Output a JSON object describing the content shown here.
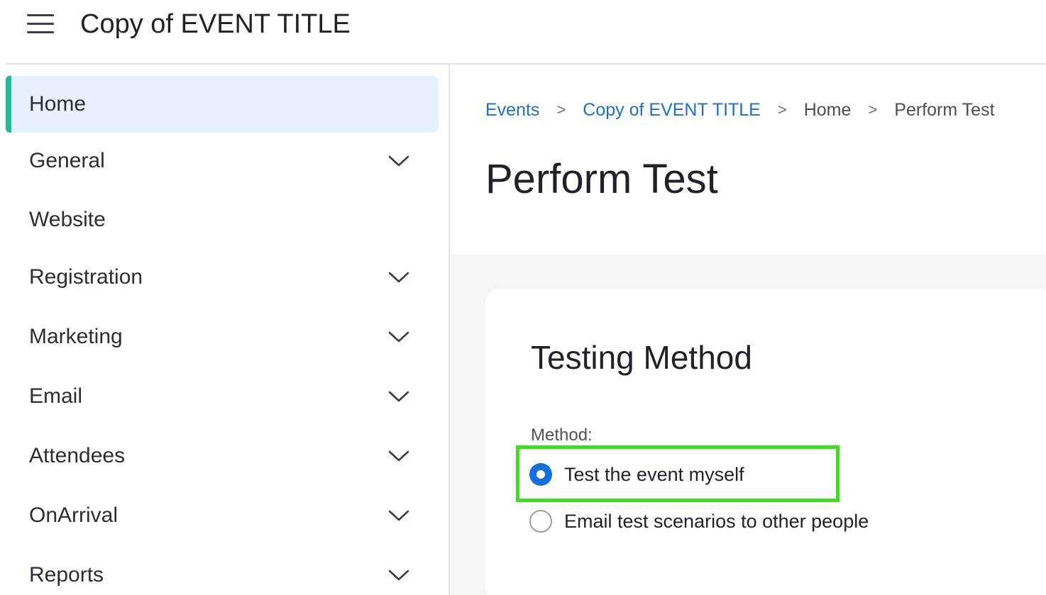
{
  "header": {
    "menu_icon": "hamburger-menu-icon",
    "title": "Copy of EVENT TITLE"
  },
  "sidebar": {
    "items": [
      {
        "label": "Home",
        "active": true,
        "expandable": false
      },
      {
        "label": "General",
        "active": false,
        "expandable": true
      },
      {
        "label": "Website",
        "active": false,
        "expandable": false
      },
      {
        "label": "Registration",
        "active": false,
        "expandable": true
      },
      {
        "label": "Marketing",
        "active": false,
        "expandable": true
      },
      {
        "label": "Email",
        "active": false,
        "expandable": true
      },
      {
        "label": "Attendees",
        "active": false,
        "expandable": true
      },
      {
        "label": "OnArrival",
        "active": false,
        "expandable": true
      },
      {
        "label": "Reports",
        "active": false,
        "expandable": true
      }
    ],
    "chevron_icon": "chevron-down-icon"
  },
  "breadcrumb": {
    "items": [
      {
        "label": "Events",
        "link": true
      },
      {
        "label": "Copy of EVENT TITLE",
        "link": true
      },
      {
        "label": "Home",
        "link": false
      },
      {
        "label": "Perform Test",
        "link": false
      }
    ],
    "separator": ">"
  },
  "page": {
    "title": "Perform Test"
  },
  "testing": {
    "section_title": "Testing Method",
    "field_label": "Method:",
    "options": [
      {
        "label": "Test the event myself",
        "selected": true
      },
      {
        "label": "Email test scenarios to other people",
        "selected": false
      }
    ]
  },
  "colors": {
    "accent": "#1370e0",
    "link": "#1a6fd6",
    "active_bg": "#e6f1fd",
    "active_marker": "#1fba9a",
    "highlight": "#3ee01e",
    "body_bg": "#f4f5f7"
  }
}
